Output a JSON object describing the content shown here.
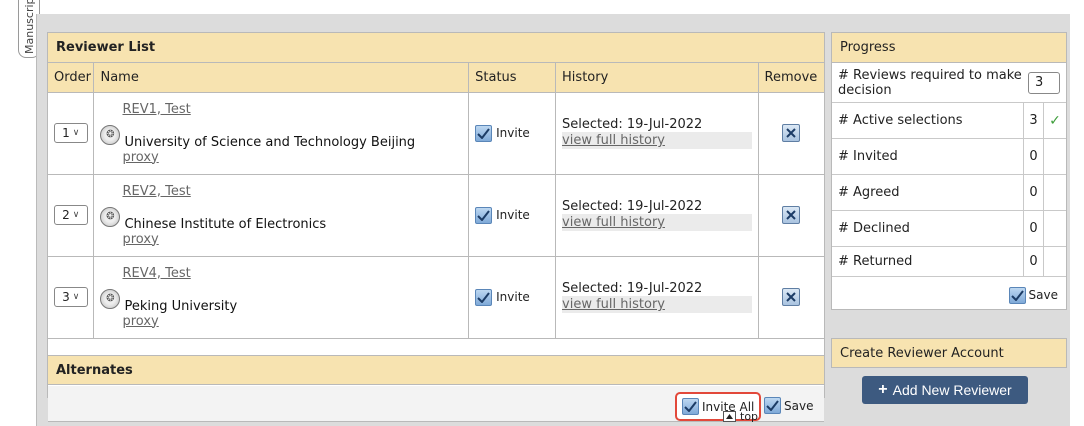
{
  "side_tab": {
    "label": "Manuscript"
  },
  "reviewer_list": {
    "title": "Reviewer List",
    "columns": {
      "order": "Order",
      "name": "Name",
      "status": "Status",
      "history": "History",
      "remove": "Remove"
    },
    "rows": [
      {
        "order": "1",
        "reviewer": "REV1, Test",
        "institution": "University of Science and Technology Beijing",
        "proxy": "proxy",
        "status": "Invite",
        "selected": "Selected: 19-Jul-2022",
        "history_link": "view full history"
      },
      {
        "order": "2",
        "reviewer": "REV2, Test",
        "institution": "Chinese Institute of Electronics",
        "proxy": "proxy",
        "status": "Invite",
        "selected": "Selected: 19-Jul-2022",
        "history_link": "view full history"
      },
      {
        "order": "3",
        "reviewer": "REV4, Test",
        "institution": "Peking University",
        "proxy": "proxy",
        "status": "Invite",
        "selected": "Selected: 19-Jul-2022",
        "history_link": "view full history"
      }
    ]
  },
  "alternates": {
    "title": "Alternates",
    "invite_all_label": "Invite All",
    "save_label": "Save",
    "top_label": "top"
  },
  "progress": {
    "title": "Progress",
    "required_label": "# Reviews required to make decision",
    "required_value": "3",
    "rows": [
      {
        "label": "# Active selections",
        "value": "3",
        "ok": true
      },
      {
        "label": "# Invited",
        "value": "0"
      },
      {
        "label": "# Agreed",
        "value": "0"
      },
      {
        "label": "# Declined",
        "value": "0"
      },
      {
        "label": "# Returned",
        "value": "0"
      }
    ],
    "save_label": "Save"
  },
  "create_account": {
    "title": "Create Reviewer Account",
    "button_label": "Add New Reviewer"
  },
  "colors": {
    "header_bg": "#f7e3b0",
    "button_bg": "#3d5a80",
    "highlight": "#e2483a",
    "ok_check": "#3d9d3a"
  }
}
